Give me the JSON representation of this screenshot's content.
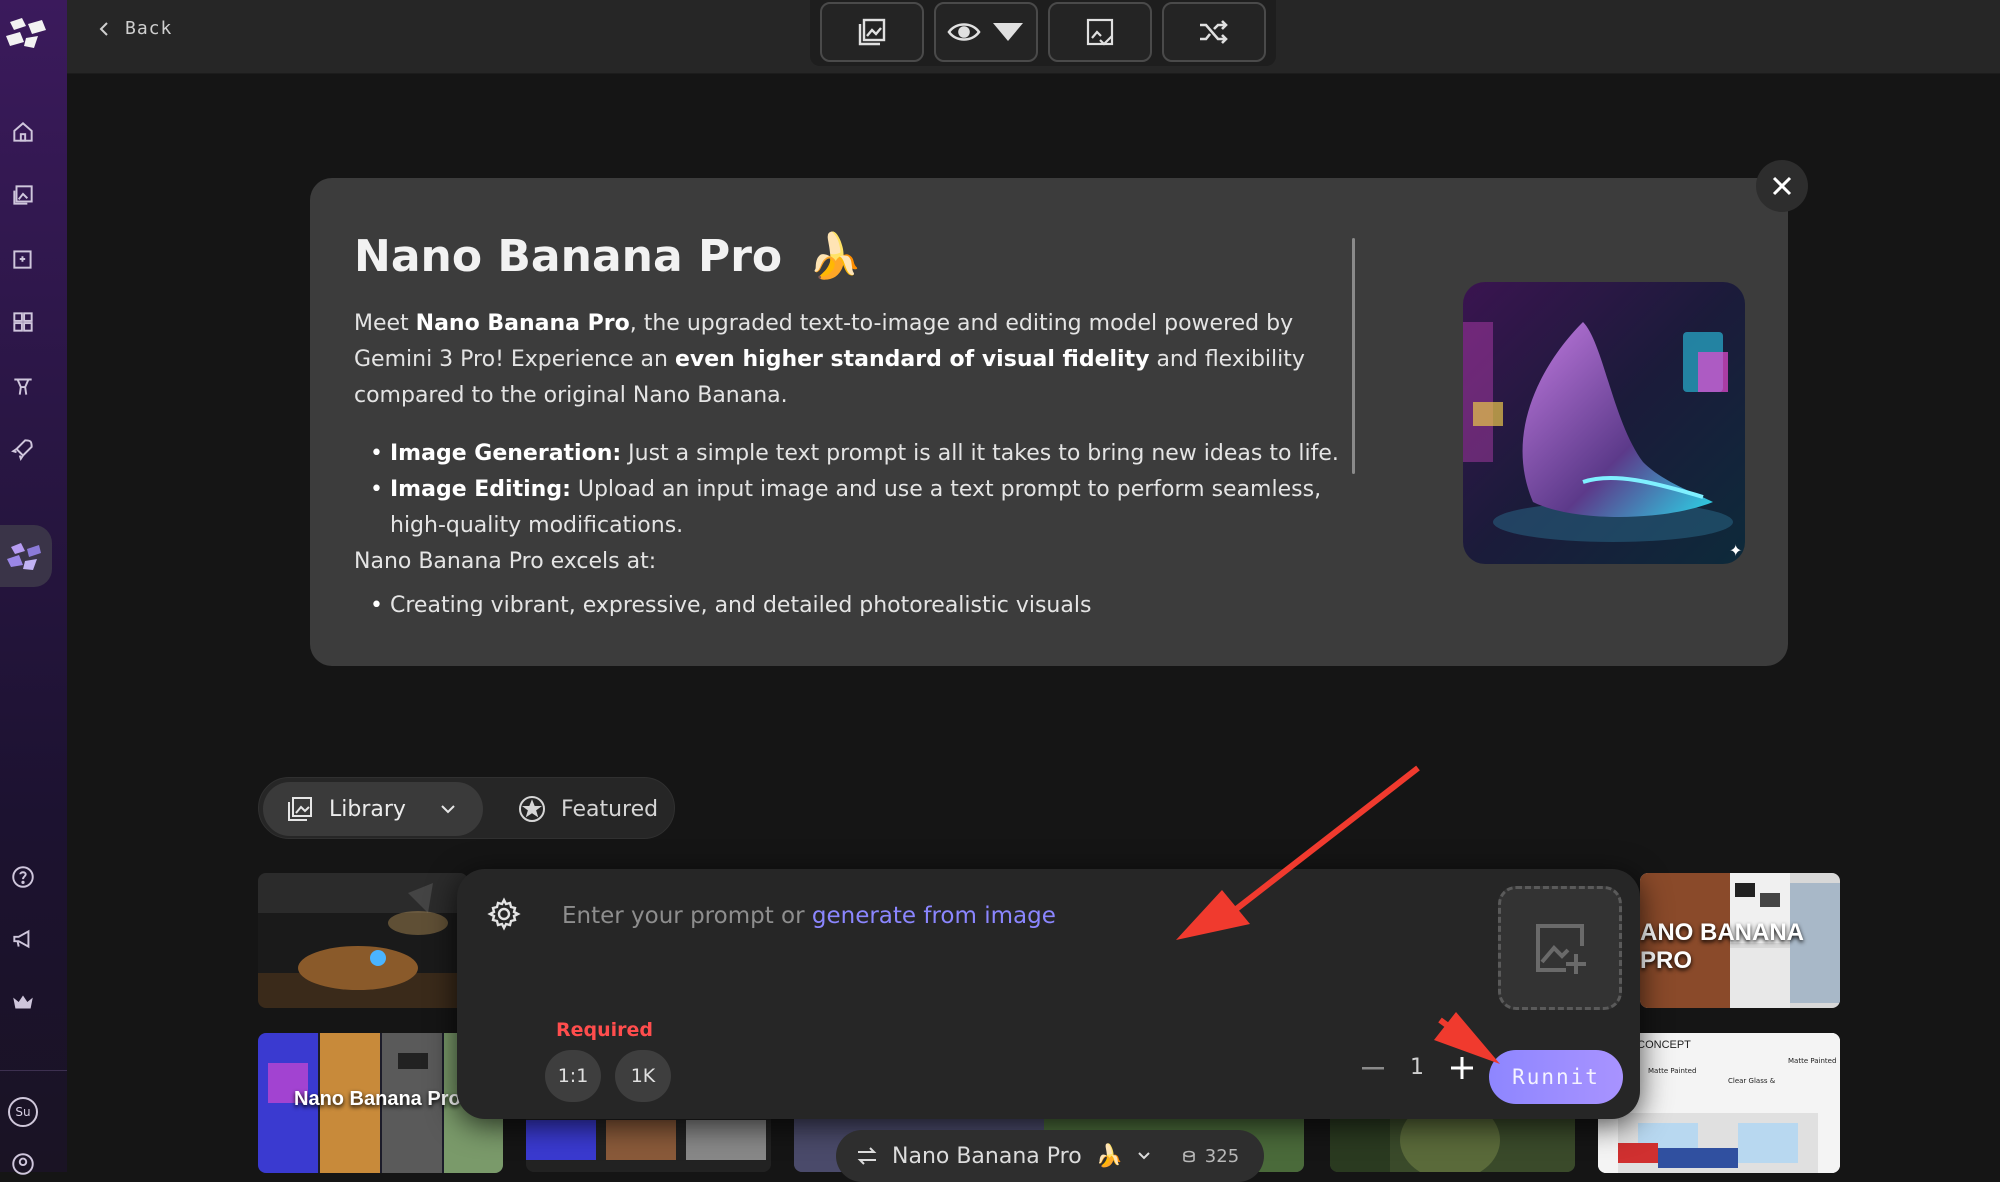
{
  "topbar": {
    "back_label": "Back",
    "tools": [
      "gallery-icon",
      "eye-icon",
      "image-check-icon",
      "shuffle-icon"
    ]
  },
  "sidebar": {
    "items": [
      "home-icon",
      "images-icon",
      "image-add-icon",
      "dashboard-icon",
      "trainer-icon",
      "rocket-icon",
      "app-logo-icon",
      "help-icon",
      "megaphone-icon",
      "crown-icon"
    ],
    "avatar_initials": "Su"
  },
  "modal": {
    "title": "Nano Banana Pro",
    "title_emoji": "🍌",
    "intro_1": "Meet ",
    "intro_b1": "Nano Banana Pro",
    "intro_2": ", the upgraded text-to-image and editing model powered by Gemini 3 Pro! Experience an ",
    "intro_b2": "even higher standard of visual fidelity",
    "intro_3": " and flexibility compared to the original Nano Banana.",
    "bullet1_b": "Image Generation:",
    "bullet1_t": " Just a simple text prompt is all it takes to bring new ideas to life.",
    "bullet2_b": "Image Editing:",
    "bullet2_t": " Upload an input image and use a text prompt to perform seamless, high-quality modifications.",
    "excels": "Nano Banana Pro excels at:",
    "cut_bullet": "Creating vibrant, expressive, and detailed photorealistic visuals"
  },
  "tabs": {
    "library": "Library",
    "featured": "Featured"
  },
  "prompt": {
    "placeholder": "Enter your prompt or ",
    "link": "generate from image",
    "required": "Required",
    "aspect": "1:1",
    "resolution": "1K",
    "quantity": "1",
    "run_label": "Runnit"
  },
  "gallery": {
    "tile_banana_pro_text": "ANO BANANA PRO",
    "tile_nano_text": "Nano Banana Pro",
    "tile_living": "LIVING CONCEPT"
  },
  "model_pill": {
    "name": "Nano Banana Pro",
    "emoji": "🍌",
    "count": "325"
  },
  "colors": {
    "accent": "#8e86ff",
    "required": "#ff4d4d",
    "annotation_arrow": "#f03a2e"
  }
}
